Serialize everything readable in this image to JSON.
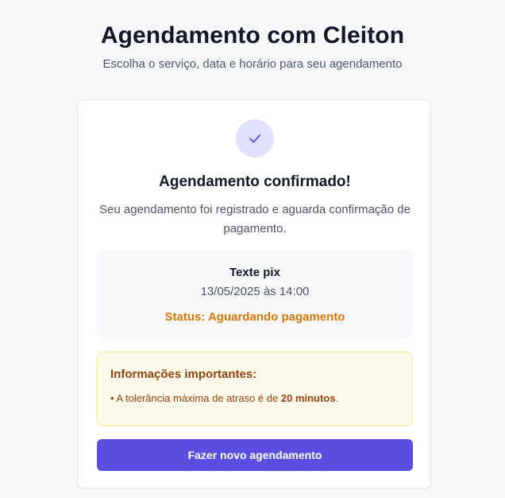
{
  "header": {
    "title": "Agendamento com Cleiton",
    "subtitle": "Escolha o serviço, data e horário para seu agendamento"
  },
  "confirmation": {
    "icon": "check-icon",
    "title": "Agendamento confirmado!",
    "message": "Seu agendamento foi registrado e aguarda confirmação de pagamento."
  },
  "details": {
    "service": "Texte pix",
    "datetime": "13/05/2025 às 14:00",
    "status": "Status: Aguardando pagamento"
  },
  "info": {
    "title": "Informações importantes:",
    "item_prefix": "• A tolerância máxima de atraso é de ",
    "item_highlight": "20 minutos",
    "item_suffix": "."
  },
  "actions": {
    "new_booking_label": "Fazer novo agendamento"
  },
  "colors": {
    "accent": "#5b4de0",
    "status": "#d97706",
    "info_text": "#92400e",
    "info_bg": "#fefaea"
  }
}
